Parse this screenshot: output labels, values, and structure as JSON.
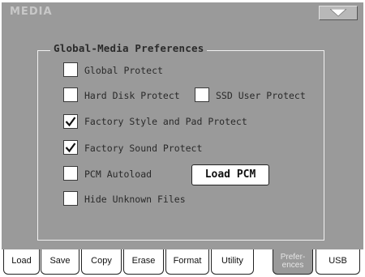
{
  "app": {
    "title": "MEDIA"
  },
  "menu": {
    "icon": "triangle-down-icon"
  },
  "group": {
    "title": "Global-Media Preferences"
  },
  "options": [
    {
      "label": "Global Protect",
      "checked": false
    },
    {
      "label": "Hard Disk Protect",
      "checked": false
    },
    {
      "label": "SSD User Protect",
      "checked": false
    },
    {
      "label": "Factory Style and Pad Protect",
      "checked": true
    },
    {
      "label": "Factory Sound Protect",
      "checked": true
    },
    {
      "label": "PCM Autoload",
      "checked": false
    },
    {
      "label": "Hide Unknown Files",
      "checked": false
    }
  ],
  "buttons": {
    "load_pcm": "Load PCM"
  },
  "tabs": [
    {
      "label": "Load"
    },
    {
      "label": "Save"
    },
    {
      "label": "Copy"
    },
    {
      "label": "Erase"
    },
    {
      "label": "Format"
    },
    {
      "label": "Utility"
    },
    {
      "label_line1": "Prefer-",
      "label_line2": "ences",
      "active": true
    },
    {
      "label": "USB"
    }
  ]
}
